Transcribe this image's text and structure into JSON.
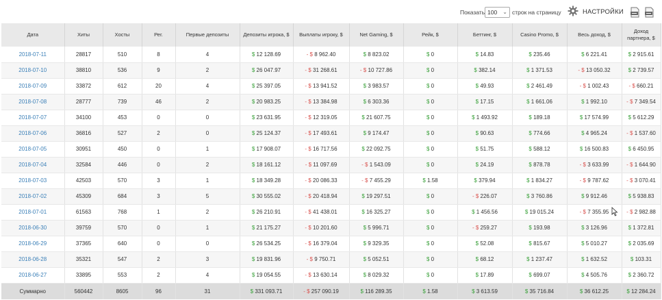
{
  "toolbar": {
    "show_label": "Показать",
    "page_size": "100",
    "per_page_label": "строк на страницу",
    "settings_label": "НАСТРОЙКИ",
    "icons": [
      "gear-icon",
      "export-xls-icon",
      "export-csv-icon"
    ]
  },
  "columns": [
    "Дата",
    "Хиты",
    "Хосты",
    "Рег.",
    "Первые депозиты",
    "Депозиты игрока, $",
    "Выплаты игроку, $",
    "Net Gaming, $",
    "Рейк, $",
    "Беттинг, $",
    "Casino Promo, $",
    "Весь доход, $",
    "Доход партнера, $"
  ],
  "colors": {
    "positive": "#3aa13a",
    "negative": "#d9534f",
    "link": "#3a7fb7",
    "header_bg": "#e9e9e9",
    "total_bg": "#dcdcdc"
  },
  "rows": [
    [
      "2018-07-11",
      "28817",
      "510",
      "8",
      "4",
      "$ 12 128.69",
      "- $ 8 962.40",
      "$ 8 823.02",
      "$ 0",
      "$ 14.83",
      "$ 235.46",
      "$ 6 221.41",
      "$ 2 915.61"
    ],
    [
      "2018-07-10",
      "38810",
      "536",
      "9",
      "2",
      "$ 26 047.97",
      "- $ 31 268.61",
      "- $ 10 727.86",
      "$ 0",
      "$ 382.14",
      "$ 1 371.53",
      "- $ 13 050.32",
      "$ 2 739.57"
    ],
    [
      "2018-07-09",
      "33872",
      "612",
      "20",
      "4",
      "$ 25 397.05",
      "- $ 13 941.52",
      "$ 3 983.57",
      "$ 0",
      "$ 49.93",
      "$ 2 461.49",
      "- $ 1 002.43",
      "- $ 660.21"
    ],
    [
      "2018-07-08",
      "28777",
      "739",
      "46",
      "2",
      "$ 20 983.25",
      "- $ 13 384.98",
      "$ 6 303.36",
      "$ 0",
      "$ 17.15",
      "$ 1 661.06",
      "$ 1 992.10",
      "- $ 7 349.54"
    ],
    [
      "2018-07-07",
      "34100",
      "453",
      "0",
      "0",
      "$ 23 631.95",
      "- $ 12 319.05",
      "$ 21 607.75",
      "$ 0",
      "$ 1 493.92",
      "$ 189.18",
      "$ 17 574.99",
      "$ 5 612.29"
    ],
    [
      "2018-07-06",
      "36816",
      "527",
      "2",
      "0",
      "$ 25 124.37",
      "- $ 17 493.61",
      "$ 9 174.47",
      "$ 0",
      "$ 90.63",
      "$ 774.66",
      "$ 4 965.24",
      "- $ 1 537.60"
    ],
    [
      "2018-07-05",
      "30951",
      "450",
      "0",
      "1",
      "$ 17 908.07",
      "- $ 16 717.56",
      "$ 22 092.75",
      "$ 0",
      "$ 51.75",
      "$ 588.12",
      "$ 16 500.83",
      "$ 6 450.95"
    ],
    [
      "2018-07-04",
      "32584",
      "446",
      "0",
      "2",
      "$ 18 161.12",
      "- $ 11 097.69",
      "- $ 1 543.09",
      "$ 0",
      "$ 24.19",
      "$ 878.78",
      "- $ 3 633.99",
      "- $ 1 644.90"
    ],
    [
      "2018-07-03",
      "42503",
      "570",
      "3",
      "1",
      "$ 18 349.28",
      "- $ 20 086.33",
      "- $ 7 455.29",
      "$ 1.58",
      "$ 379.94",
      "$ 1 834.27",
      "- $ 9 787.62",
      "- $ 3 070.41"
    ],
    [
      "2018-07-02",
      "45309",
      "684",
      "3",
      "5",
      "$ 30 555.02",
      "- $ 20 418.94",
      "$ 19 297.51",
      "$ 0",
      "- $ 226.07",
      "$ 3 760.86",
      "$ 9 912.46",
      "$ 5 938.83"
    ],
    [
      "2018-07-01",
      "61563",
      "768",
      "1",
      "2",
      "$ 26 210.91",
      "- $ 41 438.01",
      "$ 16 325.27",
      "$ 0",
      "$ 1 456.56",
      "$ 19 015.24",
      "- $ 7 355.95",
      "- $ 2 982.88"
    ],
    [
      "2018-06-30",
      "39759",
      "570",
      "0",
      "1",
      "$ 21 175.27",
      "- $ 10 201.60",
      "$ 5 996.71",
      "$ 0",
      "- $ 259.27",
      "$ 193.98",
      "$ 3 126.96",
      "$ 1 372.81"
    ],
    [
      "2018-06-29",
      "37365",
      "640",
      "0",
      "0",
      "$ 26 534.25",
      "- $ 16 379.04",
      "$ 9 329.35",
      "$ 0",
      "$ 52.08",
      "$ 815.67",
      "$ 5 010.27",
      "$ 2 035.69"
    ],
    [
      "2018-06-28",
      "35321",
      "547",
      "2",
      "3",
      "$ 19 831.96",
      "- $ 9 750.71",
      "$ 5 052.51",
      "$ 0",
      "$ 68.12",
      "$ 1 237.47",
      "$ 1 632.52",
      "$ 103.31"
    ],
    [
      "2018-06-27",
      "33895",
      "553",
      "2",
      "4",
      "$ 19 054.55",
      "- $ 13 630.14",
      "$ 8 029.32",
      "$ 0",
      "$ 17.89",
      "$ 699.07",
      "$ 4 505.76",
      "$ 2 360.72"
    ]
  ],
  "total": [
    "Суммарно",
    "560442",
    "8605",
    "96",
    "31",
    "$ 331 093.71",
    "- $ 257 090.19",
    "$ 116 289.35",
    "$ 1.58",
    "$ 3 613.59",
    "$ 35 716.84",
    "$ 36 612.25",
    "$ 12 284.24"
  ]
}
